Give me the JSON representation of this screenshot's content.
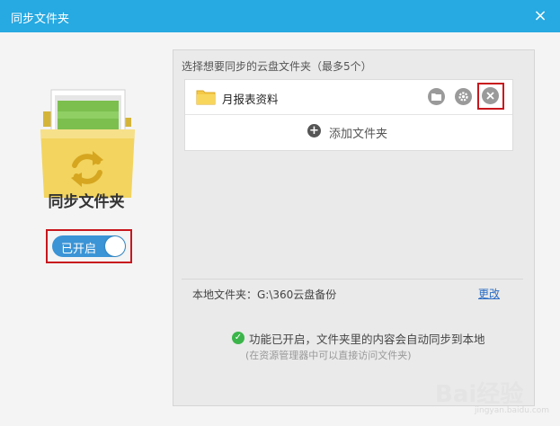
{
  "window": {
    "title": "同步文件夹",
    "close_glyph": "×"
  },
  "left": {
    "title": "同步文件夹",
    "toggle_label": "已开启",
    "toggle_on": true
  },
  "panel": {
    "hint": "选择想要同步的云盘文件夹（最多5个）",
    "folders": [
      {
        "name": "月报表资料"
      }
    ],
    "add_label": "添加文件夹",
    "add_glyph": "+",
    "local_path": "本地文件夹：G:\\360云盘备份",
    "change_label": "更改",
    "status_text": "功能已开启，文件夹里的内容会自动同步到本地",
    "status_sub": "(在资源管理器中可以直接访问文件夹)"
  },
  "icons": {
    "open_folder": "folder-icon",
    "settings": "gear-icon",
    "remove": "remove-icon",
    "add": "plus-circle-icon",
    "status": "check-circle-icon"
  },
  "colors": {
    "titlebar": "#27a9e1",
    "toggle": "#3a94d6",
    "highlight": "#c8161d",
    "link": "#2b6cc4",
    "status": "#3bb54a"
  },
  "watermark": {
    "text": "Bai经验",
    "sub": "jingyan.baidu.com"
  }
}
